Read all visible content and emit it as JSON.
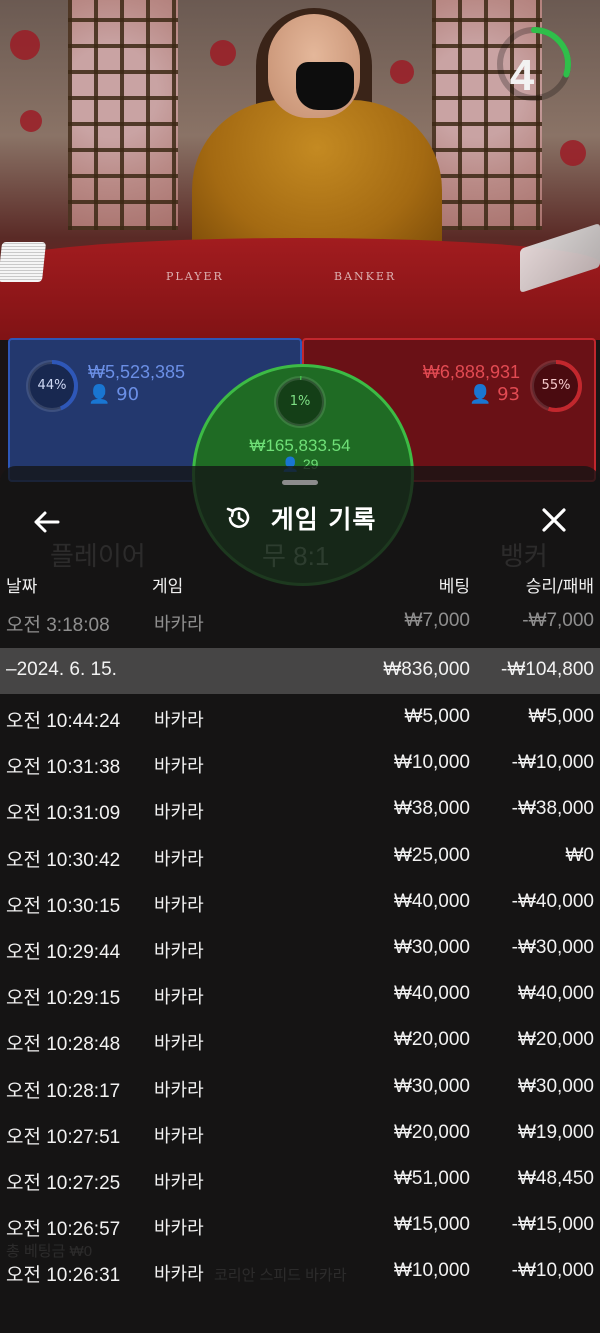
{
  "stream": {
    "timer_value": "4",
    "timer_fraction": 0.3,
    "table_label_player": "PLAYER",
    "table_label_banker": "BANKER"
  },
  "bets": {
    "player": {
      "percent": "44%",
      "percent_value": 0.44,
      "amount": "₩5,523,385",
      "players": "90",
      "color": "#2e57b8"
    },
    "tie": {
      "percent": "1%",
      "percent_value": 0.01,
      "amount": "₩165,833.54",
      "players": "29",
      "color": "#3dbb45"
    },
    "banker": {
      "percent": "55%",
      "percent_value": 0.55,
      "amount": "₩6,888,931",
      "players": "93",
      "color": "#c2272d"
    }
  },
  "background_text": {
    "player_label": "플레이어",
    "tie_label": "무 8:1",
    "banker_label": "뱅커",
    "bottom_line": "코리안 스피드 바카라",
    "balance_line": "총 베팅금 ₩0"
  },
  "sheet": {
    "title": "게임 기록",
    "columns": {
      "date": "날짜",
      "game": "게임",
      "bet": "베팅",
      "result": "승리/패배"
    },
    "top_row": {
      "time": "오전 3:18:08",
      "game": "바카라",
      "bet": "₩7,000",
      "result": "-₩7,000"
    },
    "date_group": {
      "date": "–2024. 6. 15.",
      "bet_total": "₩836,000",
      "result_total": "-₩104,800"
    },
    "rows": [
      {
        "time": "오전 10:44:24",
        "game": "바카라",
        "bet": "₩5,000",
        "result": "₩5,000"
      },
      {
        "time": "오전 10:31:38",
        "game": "바카라",
        "bet": "₩10,000",
        "result": "-₩10,000"
      },
      {
        "time": "오전 10:31:09",
        "game": "바카라",
        "bet": "₩38,000",
        "result": "-₩38,000"
      },
      {
        "time": "오전 10:30:42",
        "game": "바카라",
        "bet": "₩25,000",
        "result": "₩0"
      },
      {
        "time": "오전 10:30:15",
        "game": "바카라",
        "bet": "₩40,000",
        "result": "-₩40,000"
      },
      {
        "time": "오전 10:29:44",
        "game": "바카라",
        "bet": "₩30,000",
        "result": "-₩30,000"
      },
      {
        "time": "오전 10:29:15",
        "game": "바카라",
        "bet": "₩40,000",
        "result": "₩40,000"
      },
      {
        "time": "오전 10:28:48",
        "game": "바카라",
        "bet": "₩20,000",
        "result": "₩20,000"
      },
      {
        "time": "오전 10:28:17",
        "game": "바카라",
        "bet": "₩30,000",
        "result": "₩30,000"
      },
      {
        "time": "오전 10:27:51",
        "game": "바카라",
        "bet": "₩20,000",
        "result": "₩19,000"
      },
      {
        "time": "오전 10:27:25",
        "game": "바카라",
        "bet": "₩51,000",
        "result": "₩48,450"
      },
      {
        "time": "오전 10:26:57",
        "game": "바카라",
        "bet": "₩15,000",
        "result": "-₩15,000"
      },
      {
        "time": "오전 10:26:31",
        "game": "바카라",
        "bet": "₩10,000",
        "result": "-₩10,000"
      }
    ]
  }
}
